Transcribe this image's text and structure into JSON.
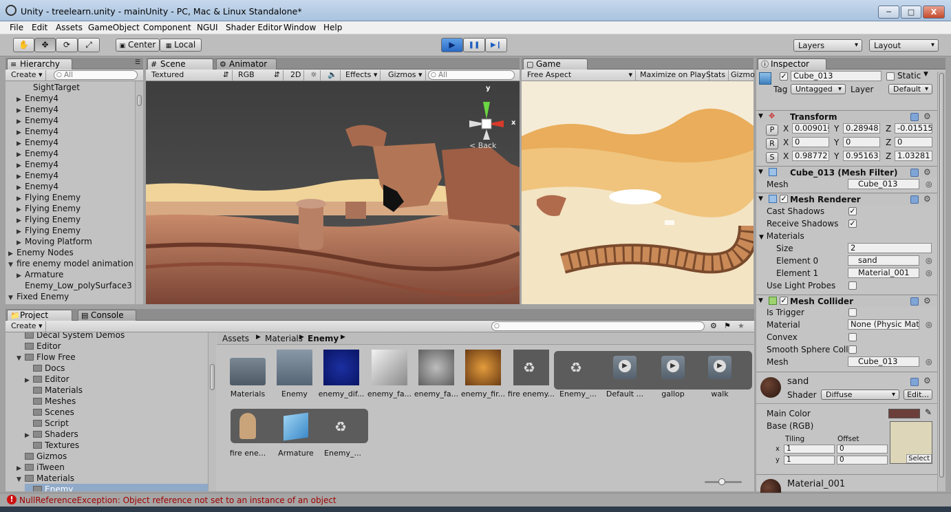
{
  "window": {
    "title": "Unity - treelearn.unity - mainUnity - PC, Mac & Linux Standalone*",
    "minimize": "─",
    "maximize": "□",
    "close": "X"
  },
  "menu": [
    "File",
    "Edit",
    "Assets",
    "GameObject",
    "Component",
    "NGUI",
    "Shader Editor",
    "Window",
    "Help"
  ],
  "toolbar": {
    "pivot": "Center",
    "space": "Local",
    "play": "▶",
    "pause": "❚❚",
    "step": "▶❙",
    "layers": "Layers",
    "layout": "Layout",
    "tool_icons": [
      "hand-icon",
      "move-icon",
      "rotate-icon",
      "scale-icon"
    ]
  },
  "hierarchy": {
    "tab": "Hierarchy",
    "create": "Create",
    "search": "All",
    "rows": [
      {
        "label": "SightTarget",
        "indent": 3,
        "arrow": ""
      },
      {
        "label": "Enemy4",
        "indent": 2,
        "arrow": "▶"
      },
      {
        "label": "Enemy4",
        "indent": 2,
        "arrow": "▶"
      },
      {
        "label": "Enemy4",
        "indent": 2,
        "arrow": "▶"
      },
      {
        "label": "Enemy4",
        "indent": 2,
        "arrow": "▶"
      },
      {
        "label": "Enemy4",
        "indent": 2,
        "arrow": "▶"
      },
      {
        "label": "Enemy4",
        "indent": 2,
        "arrow": "▶"
      },
      {
        "label": "Enemy4",
        "indent": 2,
        "arrow": "▶"
      },
      {
        "label": "Enemy4",
        "indent": 2,
        "arrow": "▶"
      },
      {
        "label": "Enemy4",
        "indent": 2,
        "arrow": "▶"
      },
      {
        "label": "Flying Enemy",
        "indent": 2,
        "arrow": "▶"
      },
      {
        "label": "Flying Enemy",
        "indent": 2,
        "arrow": "▶"
      },
      {
        "label": "Flying Enemy",
        "indent": 2,
        "arrow": "▶"
      },
      {
        "label": "Flying Enemy",
        "indent": 2,
        "arrow": "▶"
      },
      {
        "label": "Moving Platform",
        "indent": 2,
        "arrow": "▶"
      },
      {
        "label": "Enemy Nodes",
        "indent": 1,
        "arrow": "▶"
      },
      {
        "label": "fire enemy model animation u",
        "indent": 1,
        "arrow": "▼"
      },
      {
        "label": "Armature",
        "indent": 2,
        "arrow": "▶"
      },
      {
        "label": "Enemy_Low_polySurface3",
        "indent": 2,
        "arrow": ""
      },
      {
        "label": "Fixed Enemy",
        "indent": 1,
        "arrow": "▼"
      }
    ]
  },
  "scene": {
    "tab": "Scene",
    "animator_tab": "Animator",
    "shading": "Textured",
    "render": "RGB",
    "mode2d": "2D",
    "effects": "Effects",
    "gizmos": "Gizmos",
    "search": "All",
    "gizmo_back": "< Back",
    "axis_y": "y",
    "axis_x": "x"
  },
  "game": {
    "tab": "Game",
    "aspect": "Free Aspect",
    "maximize": "Maximize on Play",
    "stats": "Stats",
    "gizmos": "Gizmo"
  },
  "project": {
    "tab": "Project",
    "console_tab": "Console",
    "create": "Create",
    "tree": [
      {
        "label": "Decal System Demos",
        "indent": 2,
        "arrow": ""
      },
      {
        "label": "Editor",
        "indent": 2,
        "arrow": ""
      },
      {
        "label": "Flow Free",
        "indent": 2,
        "arrow": "▼"
      },
      {
        "label": "Docs",
        "indent": 3,
        "arrow": ""
      },
      {
        "label": "Editor",
        "indent": 3,
        "arrow": "▶"
      },
      {
        "label": "Materials",
        "indent": 3,
        "arrow": ""
      },
      {
        "label": "Meshes",
        "indent": 3,
        "arrow": ""
      },
      {
        "label": "Scenes",
        "indent": 3,
        "arrow": ""
      },
      {
        "label": "Script",
        "indent": 3,
        "arrow": ""
      },
      {
        "label": "Shaders",
        "indent": 3,
        "arrow": "▶"
      },
      {
        "label": "Textures",
        "indent": 3,
        "arrow": ""
      },
      {
        "label": "Gizmos",
        "indent": 2,
        "arrow": ""
      },
      {
        "label": "iTween",
        "indent": 2,
        "arrow": "▶"
      },
      {
        "label": "Materials",
        "indent": 2,
        "arrow": "▼"
      },
      {
        "label": "Enemy",
        "indent": 3,
        "arrow": ""
      }
    ],
    "breadcrumb": [
      "Assets",
      "Materials",
      "Enemy"
    ],
    "assets_row1": [
      {
        "label": "Materials",
        "kind": "folder"
      },
      {
        "label": "Enemy",
        "kind": "prefab"
      },
      {
        "label": "enemy_dif...",
        "kind": "tex-blue"
      },
      {
        "label": "enemy_fa...",
        "kind": "tex-gray"
      },
      {
        "label": "enemy_fa...",
        "kind": "tex-noise"
      },
      {
        "label": "enemy_fir...",
        "kind": "tex-orange"
      },
      {
        "label": "fire enemy...",
        "kind": "model"
      },
      {
        "label": "Enemy_...",
        "kind": "mesh"
      },
      {
        "label": "Default ...",
        "kind": "anim"
      },
      {
        "label": "gallop",
        "kind": "anim"
      },
      {
        "label": "walk",
        "kind": "anim"
      }
    ],
    "assets_row2": [
      {
        "label": "fire ene...",
        "kind": "avatar"
      },
      {
        "label": "Armature",
        "kind": "cube"
      },
      {
        "label": "Enemy_...",
        "kind": "mesh"
      }
    ]
  },
  "inspector": {
    "tab": "Inspector",
    "name": "Cube_013",
    "static": "Static",
    "tag_label": "Tag",
    "tag": "Untagged",
    "layer_label": "Layer",
    "layer": "Default",
    "transform": {
      "title": "Transform",
      "p": [
        "0.00901§",
        "0.28948",
        "-0.01515"
      ],
      "r": [
        "0",
        "0",
        "0"
      ],
      "s": [
        "0.98772",
        "0.95163",
        "1.03281"
      ],
      "btn_p": "P",
      "btn_r": "R",
      "btn_s": "S"
    },
    "mesh_filter": {
      "title": "Cube_013 (Mesh Filter)",
      "mesh_label": "Mesh",
      "mesh": "Cube_013"
    },
    "mesh_renderer": {
      "title": "Mesh Renderer",
      "cast": "Cast Shadows",
      "receive": "Receive Shadows",
      "materials": "Materials",
      "size_label": "Size",
      "size": "2",
      "el0_label": "Element 0",
      "el0": "sand",
      "el1_label": "Element 1",
      "el1": "Material_001",
      "probes": "Use Light Probes"
    },
    "mesh_collider": {
      "title": "Mesh Collider",
      "trigger": "Is Trigger",
      "material_label": "Material",
      "material": "None (Physic Mate",
      "convex": "Convex",
      "smooth": "Smooth Sphere Colli",
      "mesh_label": "Mesh",
      "mesh": "Cube_013"
    },
    "material": {
      "name": "sand",
      "shader_label": "Shader",
      "shader": "Diffuse",
      "edit": "Edit...",
      "main_color": "Main Color",
      "base": "Base (RGB)",
      "tiling": "Tiling",
      "offset": "Offset",
      "tx": "1",
      "ty": "1",
      "ox": "0",
      "oy": "0",
      "x": "x",
      "y": "y",
      "select": "Select",
      "color": "#6b3e3a"
    },
    "material2": {
      "name": "Material_001"
    }
  },
  "status": {
    "error": "NullReferenceException: Object reference not set to an instance of an object"
  },
  "colors": {
    "play_accent": "#3a7fdc",
    "error_red": "#cc1111",
    "sky_game": "#f3ead7",
    "sand": "#e0a54f"
  }
}
